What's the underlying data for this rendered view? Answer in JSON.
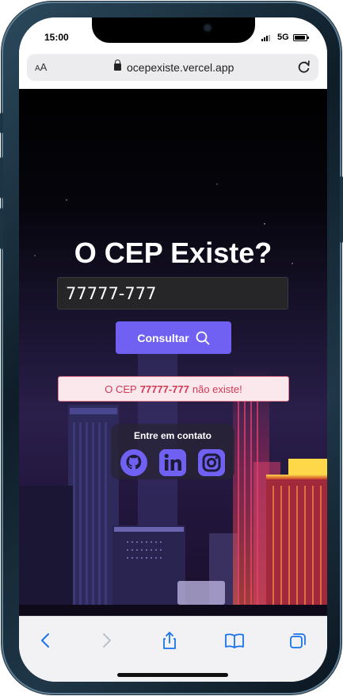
{
  "status_bar": {
    "time": "15:00",
    "network": "5G"
  },
  "browser": {
    "text_size_label": "AA",
    "url": "ocepexiste.vercel.app"
  },
  "page": {
    "title": "O CEP Existe?",
    "cep_value": "77777-777",
    "consult_label": "Consultar",
    "result": {
      "prefix": "O CEP",
      "cep": "77777-777",
      "suffix": "não existe!"
    },
    "contact_title": "Entre em contato",
    "social_links": [
      "github-icon",
      "linkedin-icon",
      "instagram-icon"
    ]
  },
  "colors": {
    "accent": "#7061f2",
    "error_bg": "#fbe8ec",
    "error_text": "#d03a55",
    "error_border": "#e27a8e"
  }
}
